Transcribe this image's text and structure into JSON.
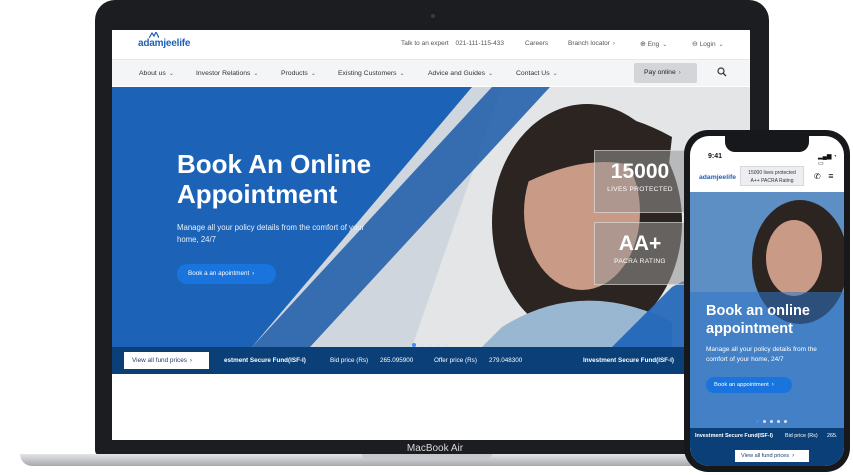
{
  "laptop": {
    "label": "MacBook Air"
  },
  "site": {
    "logo": "adamjeelife",
    "topbar": {
      "expert_label": "Talk to an expert",
      "expert_phone": "021-111-115-433",
      "careers": "Careers",
      "branch_locator": "Branch locator",
      "language": "Eng",
      "login": "Login"
    },
    "nav": {
      "items": [
        "About us",
        "Investor Relations",
        "Products",
        "Existing Customers",
        "Advice and Guides",
        "Contact Us"
      ],
      "pay_online": "Pay online"
    },
    "hero": {
      "title": "Book An Online Appointment",
      "subtitle": "Manage all your policy details from the comfort of your home, 24/7",
      "button": "Book a an apointment",
      "stats": [
        {
          "value": "15000",
          "label": "LIVES PROTECTED"
        },
        {
          "value": "AA+",
          "label": "PACRA RATING"
        }
      ],
      "slides_total": 5,
      "active_slide": 1
    },
    "ticker": {
      "fund_prices_button": "View all fund prices",
      "fund_name": "estment Secure Fund(ISF-I)",
      "bid_label": "Bid price (Rs)",
      "bid_value": "265.095900",
      "offer_label": "Offer price (Rs)",
      "offer_value": "279.048300",
      "fund_name_2": "Investment Secure Fund(ISF-I)"
    },
    "colors": {
      "primary": "#1c63b7",
      "ticker": "#0a3f78",
      "button": "#1a74de"
    }
  },
  "phone": {
    "time": "9:41",
    "logo": "adamjeelife",
    "badge_line1": "15000 lives protected",
    "badge_line2": "A++ PACRA Rating",
    "hero_title": "Book an online appointment",
    "hero_subtitle": "Manage all your policy details from the comfort of your home, 24/7",
    "hero_button": "Book an appointment",
    "ticker_fund": "Investment Secure Fund(ISF-I)",
    "ticker_bid": "Bid price (Rs)",
    "ticker_value": "265.",
    "fund_prices_button": "View all fund prices"
  }
}
